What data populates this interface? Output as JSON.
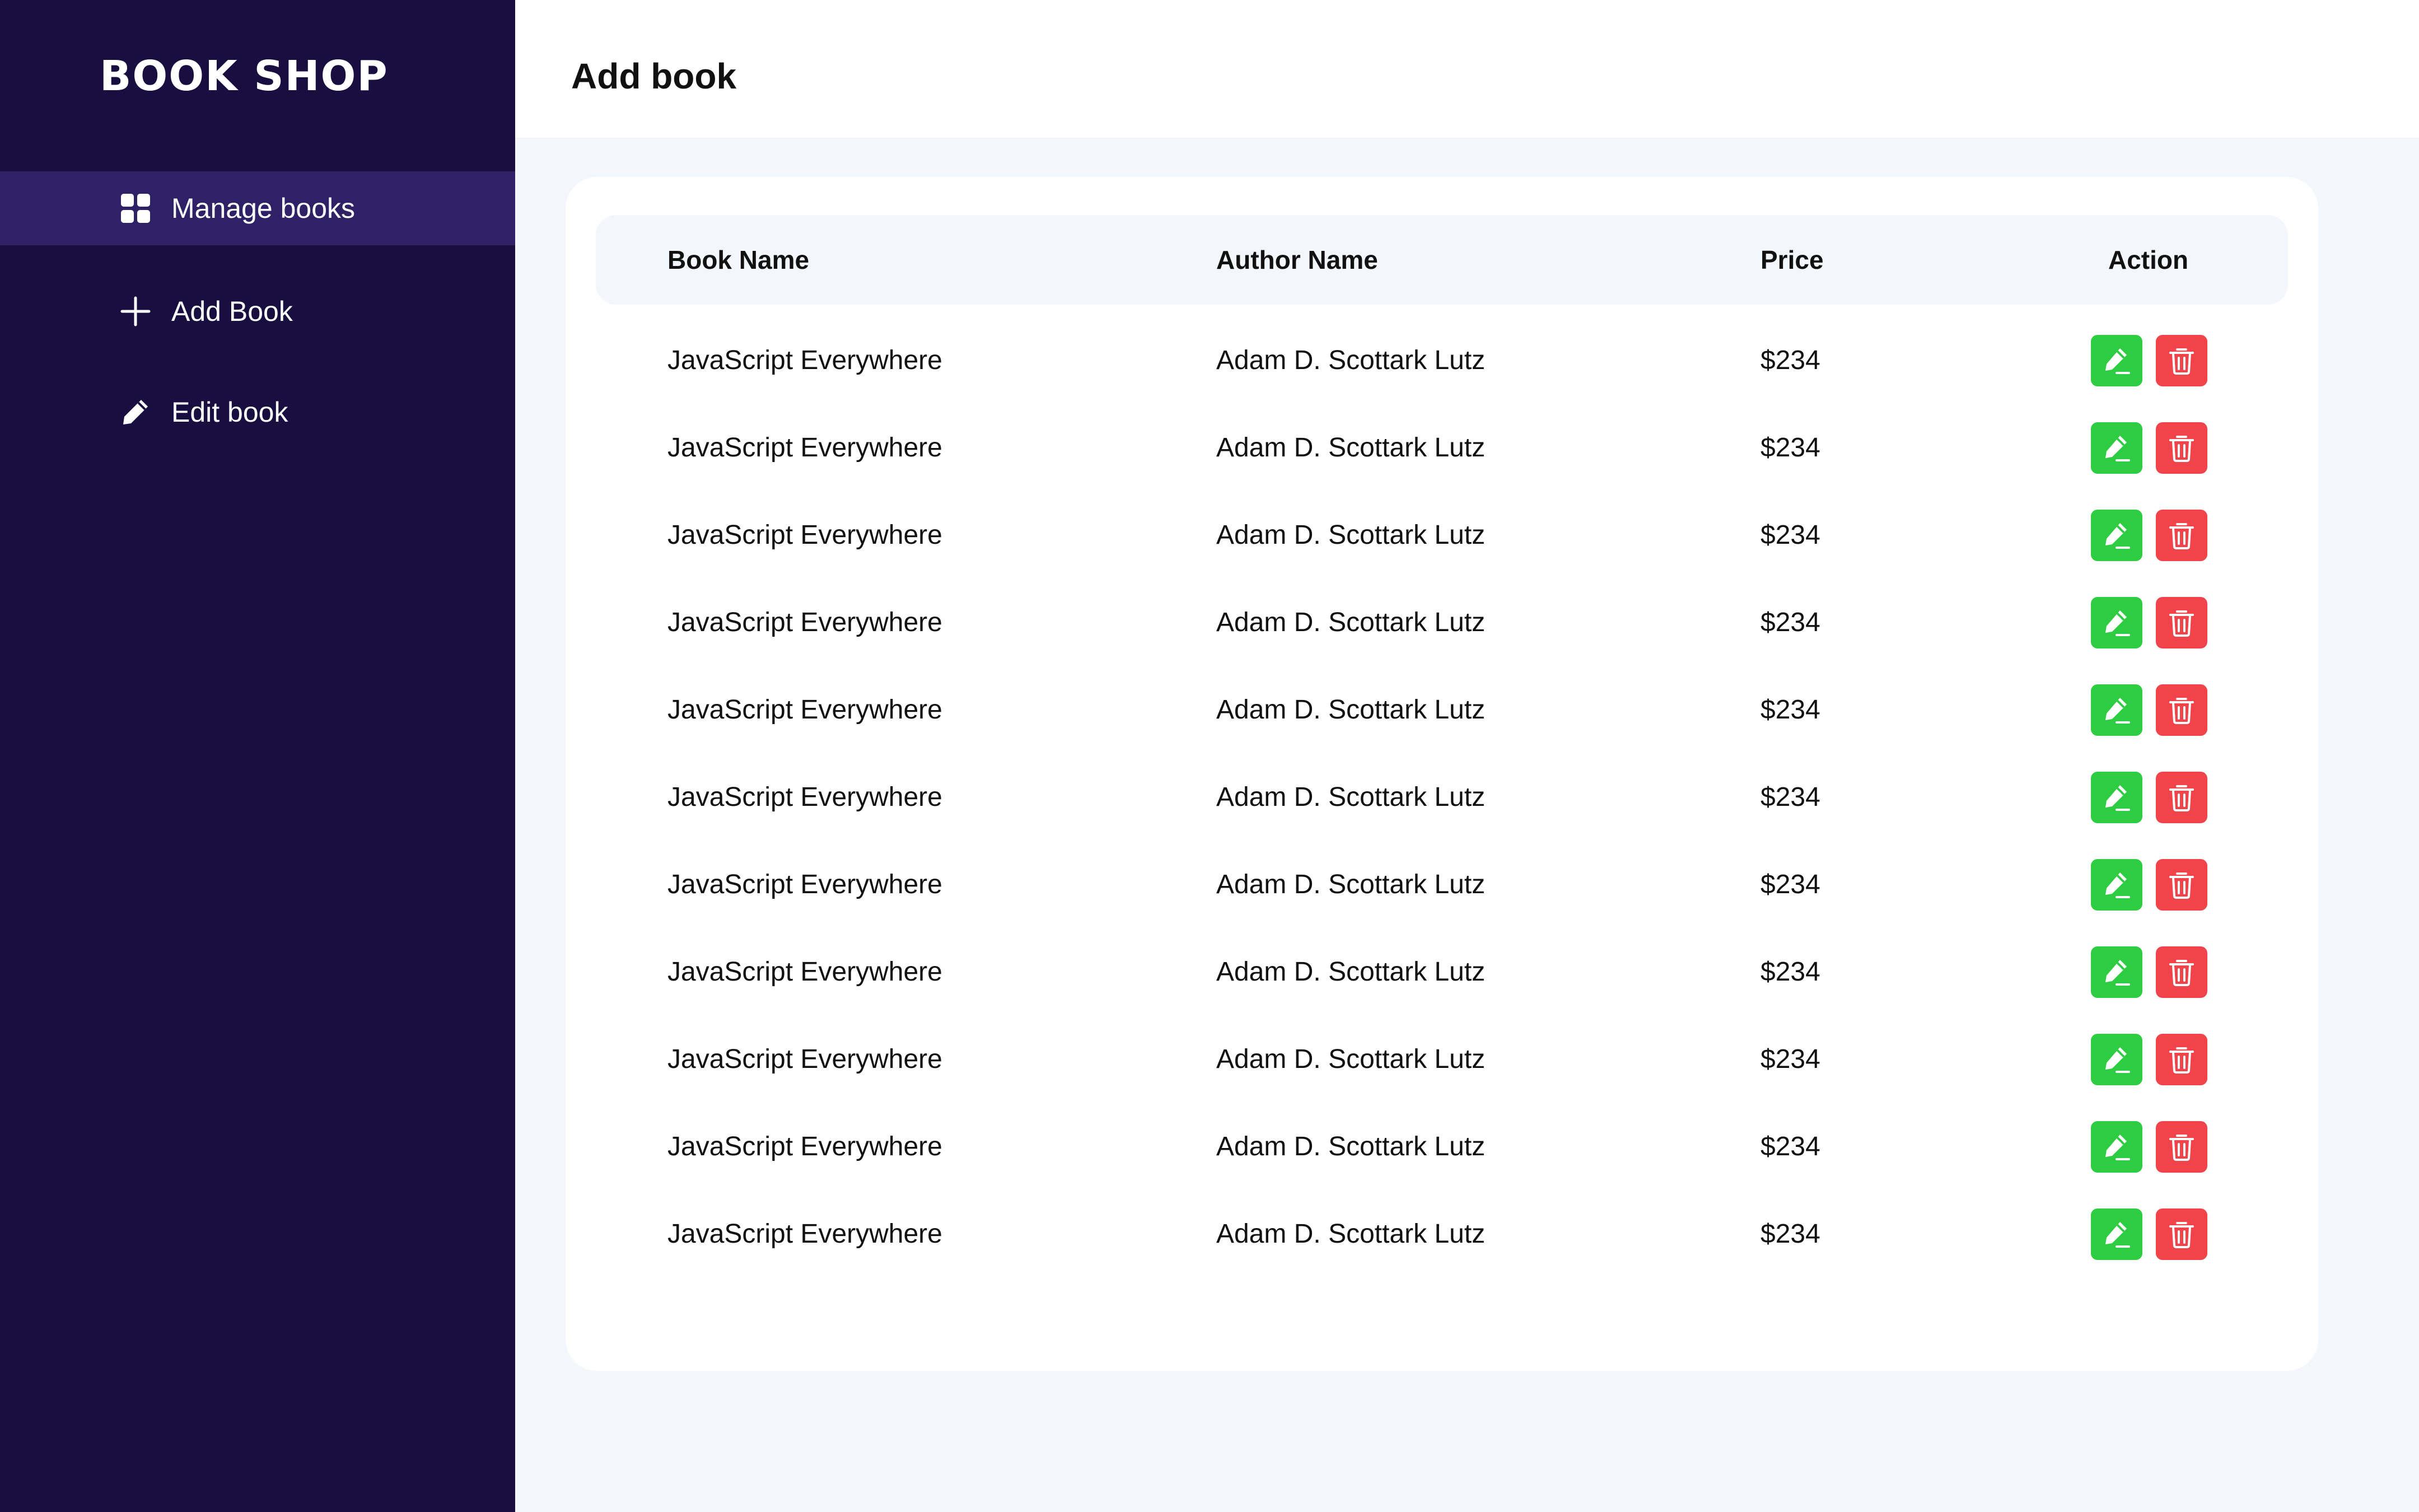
{
  "brand": "BOOK SHOP",
  "sidebar": {
    "items": [
      {
        "label": "Manage books",
        "icon": "grid-icon",
        "active": true
      },
      {
        "label": "Add Book",
        "icon": "plus-icon",
        "active": false
      },
      {
        "label": "Edit book",
        "icon": "pencil-icon",
        "active": false
      }
    ]
  },
  "header": {
    "title": "Add book"
  },
  "table": {
    "headers": {
      "name": "Book Name",
      "author": "Author Name",
      "price": "Price",
      "action": "Action"
    },
    "rows": [
      {
        "name": "JavaScript Everywhere",
        "author": "Adam D. Scottark Lutz",
        "price": "$234"
      },
      {
        "name": "JavaScript Everywhere",
        "author": "Adam D. Scottark Lutz",
        "price": "$234"
      },
      {
        "name": "JavaScript Everywhere",
        "author": "Adam D. Scottark Lutz",
        "price": "$234"
      },
      {
        "name": "JavaScript Everywhere",
        "author": "Adam D. Scottark Lutz",
        "price": "$234"
      },
      {
        "name": "JavaScript Everywhere",
        "author": "Adam D. Scottark Lutz",
        "price": "$234"
      },
      {
        "name": "JavaScript Everywhere",
        "author": "Adam D. Scottark Lutz",
        "price": "$234"
      },
      {
        "name": "JavaScript Everywhere",
        "author": "Adam D. Scottark Lutz",
        "price": "$234"
      },
      {
        "name": "JavaScript Everywhere",
        "author": "Adam D. Scottark Lutz",
        "price": "$234"
      },
      {
        "name": "JavaScript Everywhere",
        "author": "Adam D. Scottark Lutz",
        "price": "$234"
      },
      {
        "name": "JavaScript Everywhere",
        "author": "Adam D. Scottark Lutz",
        "price": "$234"
      },
      {
        "name": "JavaScript Everywhere",
        "author": "Adam D. Scottark Lutz",
        "price": "$234"
      }
    ],
    "row_actions": [
      "edit",
      "delete"
    ]
  },
  "colors": {
    "sidebar_bg": "#190E40",
    "sidebar_active": "#2E2165",
    "page_bg": "#F3F6FA",
    "edit_green": "#2ECC40",
    "delete_red": "#F0434A"
  }
}
